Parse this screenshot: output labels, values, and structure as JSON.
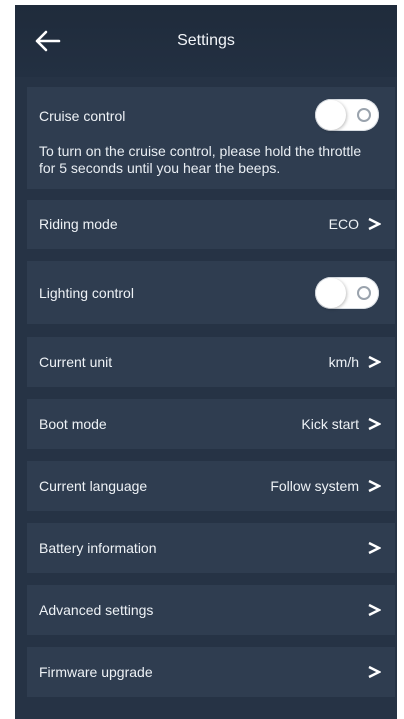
{
  "header": {
    "title": "Settings",
    "back_icon": "arrow-left-icon"
  },
  "cruise": {
    "label": "Cruise control",
    "description": "To turn on the cruise control, please hold the throttle for 5 seconds until you hear the beeps.",
    "enabled": false
  },
  "rows": {
    "riding_mode": {
      "label": "Riding mode",
      "value": "ECO"
    },
    "lighting": {
      "label": "Lighting control",
      "enabled": false
    },
    "current_unit": {
      "label": "Current unit",
      "value": "km/h"
    },
    "boot_mode": {
      "label": "Boot mode",
      "value": "Kick start"
    },
    "language": {
      "label": "Current language",
      "value": "Follow system"
    },
    "battery": {
      "label": "Battery information"
    },
    "advanced": {
      "label": "Advanced settings"
    },
    "firmware": {
      "label": "Firmware upgrade"
    }
  },
  "colors": {
    "background": "#263345",
    "card": "#2f3d50",
    "text": "#eef2f6"
  }
}
